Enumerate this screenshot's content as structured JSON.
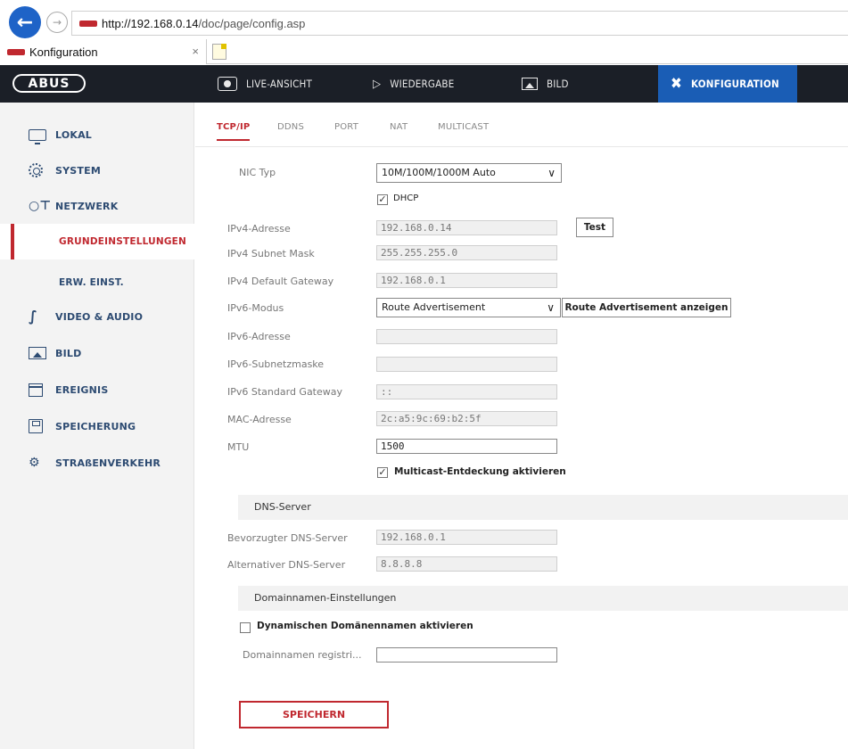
{
  "browser": {
    "back_icon": "arrow-left-icon",
    "forward_icon": "arrow-right-icon",
    "url_host": "http://192.168.0.14",
    "url_path": "/doc/page/config.asp",
    "tab_title": "Konfiguration",
    "tab_close": "×"
  },
  "topnav": {
    "logo": "ABUS",
    "items": [
      {
        "label": "LIVE-ANSICHT",
        "icon": "eye-icon"
      },
      {
        "label": "WIEDERGABE",
        "icon": "play-icon"
      },
      {
        "label": "BILD",
        "icon": "picture-icon"
      },
      {
        "label": "KONFIGURATION",
        "icon": "tools-icon"
      }
    ],
    "active_color": "#1a5db5"
  },
  "sidebar": {
    "items": [
      {
        "label": "LOKAL",
        "icon": "monitor-icon"
      },
      {
        "label": "SYSTEM",
        "icon": "gear-icon"
      },
      {
        "label": "NETZWERK",
        "icon": "network-icon"
      },
      {
        "label": "GRUNDEINSTELLUNGEN",
        "icon": ""
      },
      {
        "label": "ERW. EINST.",
        "icon": ""
      },
      {
        "label": "VIDEO & AUDIO",
        "icon": "video-icon"
      },
      {
        "label": "BILD",
        "icon": "picture-icon"
      },
      {
        "label": "EREIGNIS",
        "icon": "event-icon"
      },
      {
        "label": "SPEICHERUNG",
        "icon": "storage-icon"
      },
      {
        "label": "STRAßENVERKEHR",
        "icon": "traffic-icon"
      }
    ],
    "active_color": "#c0282f"
  },
  "tabs": [
    "TCP/IP",
    "DDNS",
    "PORT",
    "NAT",
    "MULTICAST"
  ],
  "form": {
    "nic_label": "NIC Typ",
    "nic_value": "10M/100M/1000M Auto",
    "dhcp_label": "DHCP",
    "ipv4_addr_label": "IPv4-Adresse",
    "ipv4_addr_value": "192.168.0.14",
    "test_button": "Test",
    "ipv4_mask_label": "IPv4 Subnet Mask",
    "ipv4_mask_value": "255.255.255.0",
    "ipv4_gw_label": "IPv4 Default Gateway",
    "ipv4_gw_value": "192.168.0.1",
    "ipv6_mode_label": "IPv6-Modus",
    "ipv6_mode_value": "Route Advertisement",
    "route_adv_button": "Route Advertisement anzeigen",
    "ipv6_addr_label": "IPv6-Adresse",
    "ipv6_addr_value": "",
    "ipv6_mask_label": "IPv6-Subnetzmaske",
    "ipv6_mask_value": "",
    "ipv6_gw_label": "IPv6 Standard Gateway",
    "ipv6_gw_value": "::",
    "mac_label": "MAC-Adresse",
    "mac_value": "2c:a5:9c:69:b2:5f",
    "mtu_label": "MTU",
    "mtu_value": "1500",
    "multicast_label": "Multicast-Entdeckung aktivieren"
  },
  "dns": {
    "section_title": "DNS-Server",
    "preferred_label": "Bevorzugter DNS-Server",
    "preferred_value": "192.168.0.1",
    "alternate_label": "Alternativer DNS-Server",
    "alternate_value": "8.8.8.8"
  },
  "domain": {
    "section_title": "Domainnamen-Einstellungen",
    "dynamic_label": "Dynamischen Domänennamen aktivieren",
    "register_label": "Domainnamen registri...",
    "register_value": ""
  },
  "save_button": "SPEICHERN",
  "checkmark": "✓"
}
